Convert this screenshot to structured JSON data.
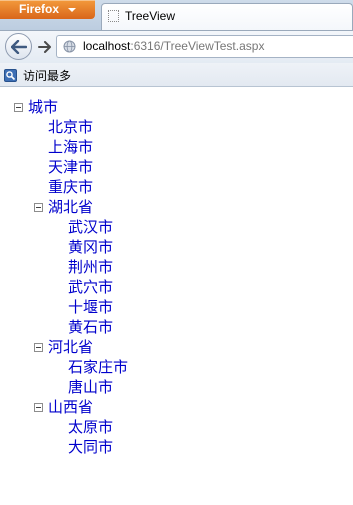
{
  "browser": {
    "menu_button_label": "Firefox",
    "tab_title": "TreeView",
    "url_host": "localhost",
    "url_rest": ":6316/TreeViewTest.aspx",
    "bookmark_label": "访问最多"
  },
  "tree": {
    "root": "城市",
    "level1_leaves": [
      "北京市",
      "上海市",
      "天津市",
      "重庆市"
    ],
    "groups": [
      {
        "label": "湖北省",
        "children": [
          "武汉市",
          "黄冈市",
          "荆州市",
          "武穴市",
          "十堰市",
          "黄石市"
        ]
      },
      {
        "label": "河北省",
        "children": [
          "石家庄市",
          "唐山市"
        ]
      },
      {
        "label": "山西省",
        "children": [
          "太原市",
          "大同市"
        ]
      }
    ]
  }
}
